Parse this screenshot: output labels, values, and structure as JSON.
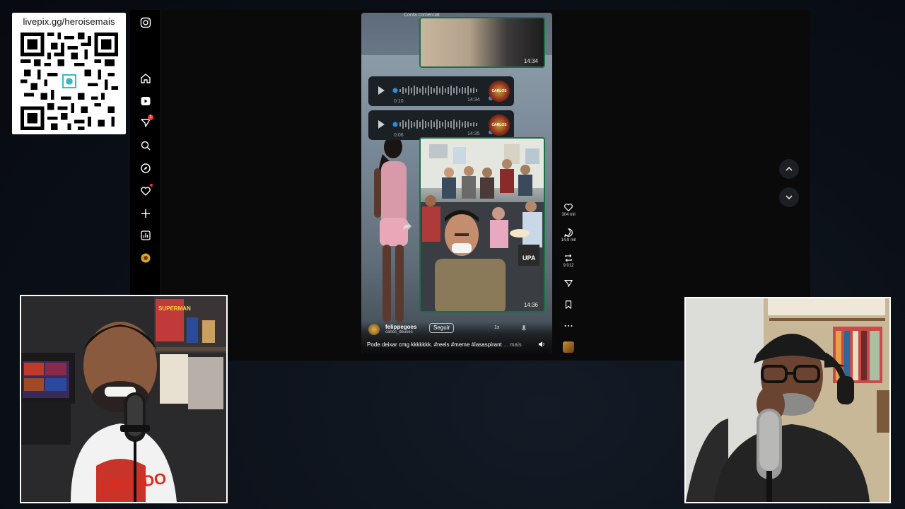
{
  "qr": {
    "url": "livepix.gg/heroisemais"
  },
  "reel": {
    "top_header": "Conta comercial",
    "top_time": "14:34",
    "audio_messages": [
      {
        "duration": "0:10",
        "time": "14:34",
        "avatar_text": "CARLOS"
      },
      {
        "duration": "0:06",
        "time": "14:35",
        "avatar_text": "CARLOS"
      }
    ],
    "photo_time": "14:36",
    "author": "felippegoes",
    "author_sub": "carlos_deuses",
    "follow_label": "Seguir",
    "speed": "1x",
    "caption": "Pode deixar cmg kkkkkkk. #reels #meme #iasaspirant",
    "caption_more": "... mais"
  },
  "actions": {
    "likes": "304 mil",
    "comments": "14,9 mil",
    "reposts": "9.012"
  },
  "colors": {
    "bubble_border": "#1f6e43",
    "notification": "#ff3040"
  },
  "icons": {
    "nav": [
      "instagram-icon",
      "home-icon",
      "reels-icon",
      "messages-icon",
      "search-icon",
      "explore-icon",
      "notifications-icon",
      "create-icon",
      "dashboard-icon",
      "profile-icon"
    ],
    "actions": [
      "heart-icon",
      "comment-icon",
      "repost-icon",
      "share-icon",
      "bookmark-icon",
      "more-icon"
    ]
  },
  "notifications": {
    "messages_badge": "1"
  }
}
